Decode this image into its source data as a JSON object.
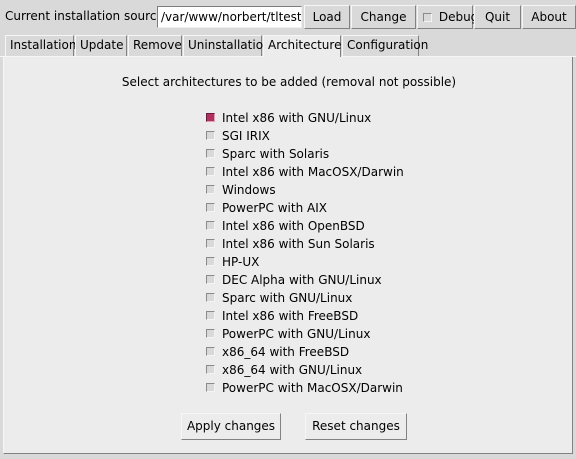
{
  "toolbar": {
    "source_label": "Current installation source:",
    "source_value": "/var/www/norbert/tltesting",
    "load_label": "Load",
    "change_label": "Change",
    "debug_label": "Debug",
    "debug_checked": false,
    "quit_label": "Quit",
    "about_label": "About"
  },
  "tabs": [
    {
      "label": "Installation",
      "active": false
    },
    {
      "label": "Update",
      "active": false
    },
    {
      "label": "Remove",
      "active": false
    },
    {
      "label": "Uninstallation",
      "active": false
    },
    {
      "label": "Architectures",
      "active": true
    },
    {
      "label": "Configuration",
      "active": false
    }
  ],
  "panel": {
    "heading": "Select architectures to be added (removal not possible)",
    "architectures": [
      {
        "label": "Intel x86 with GNU/Linux",
        "checked": true
      },
      {
        "label": "SGI IRIX",
        "checked": false
      },
      {
        "label": "Sparc with Solaris",
        "checked": false
      },
      {
        "label": "Intel x86 with MacOSX/Darwin",
        "checked": false
      },
      {
        "label": "Windows",
        "checked": false
      },
      {
        "label": "PowerPC with AIX",
        "checked": false
      },
      {
        "label": "Intel x86 with OpenBSD",
        "checked": false
      },
      {
        "label": "Intel x86 with Sun Solaris",
        "checked": false
      },
      {
        "label": "HP-UX",
        "checked": false
      },
      {
        "label": "DEC Alpha with GNU/Linux",
        "checked": false
      },
      {
        "label": "Sparc with GNU/Linux",
        "checked": false
      },
      {
        "label": "Intel x86 with FreeBSD",
        "checked": false
      },
      {
        "label": "PowerPC with GNU/Linux",
        "checked": false
      },
      {
        "label": "x86_64 with FreeBSD",
        "checked": false
      },
      {
        "label": "x86_64 with GNU/Linux",
        "checked": false
      },
      {
        "label": "PowerPC with MacOSX/Darwin",
        "checked": false
      }
    ],
    "apply_label": "Apply changes",
    "reset_label": "Reset changes"
  },
  "colors": {
    "window_bg": "#d9d9d9",
    "panel_bg": "#ececec",
    "checked_indicator": "#b03060"
  }
}
